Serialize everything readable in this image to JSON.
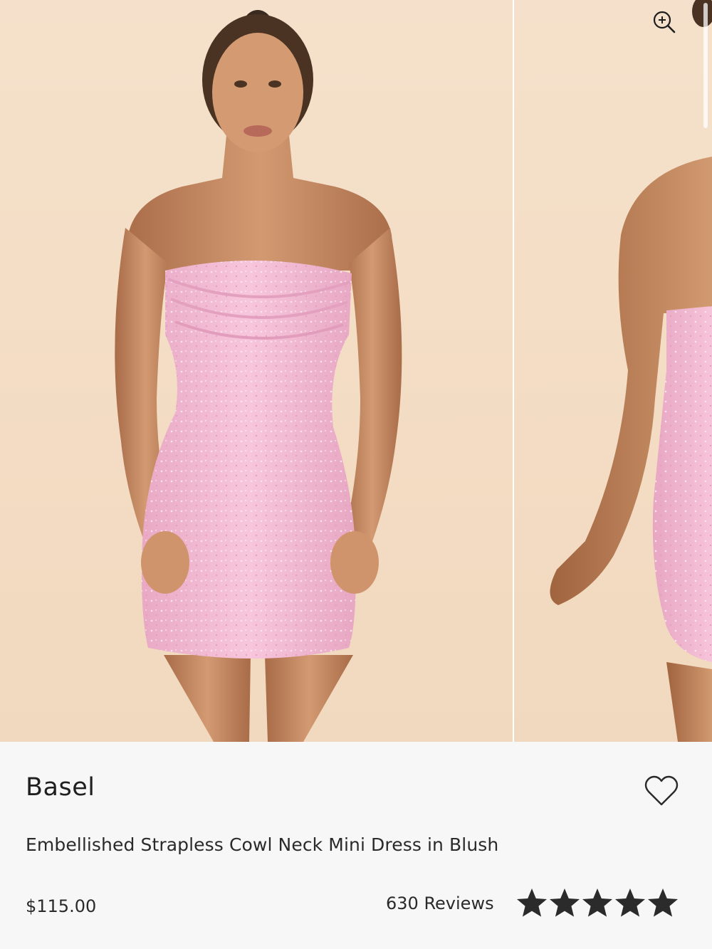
{
  "product": {
    "brand": "Basel",
    "title": "Embellished Strapless Cowl Neck Mini Dress in Blush",
    "price": "$115.00",
    "reviews_label": "630 Reviews",
    "rating": 5,
    "rating_max": 5
  },
  "gallery": {
    "images": [
      {
        "description_icon": "product-photo-front"
      },
      {
        "description_icon": "product-photo-side"
      }
    ],
    "zoom_icon": "zoom-in-icon"
  },
  "icons": {
    "wishlist": "heart-outline-icon",
    "star": "star-icon"
  },
  "colors": {
    "backdrop": "#f3dcc3",
    "dress": "#f2b9d2",
    "skin": "#c88b62",
    "panel": "#f7f7f7",
    "text": "#222222",
    "star": "#2b2b2b"
  }
}
